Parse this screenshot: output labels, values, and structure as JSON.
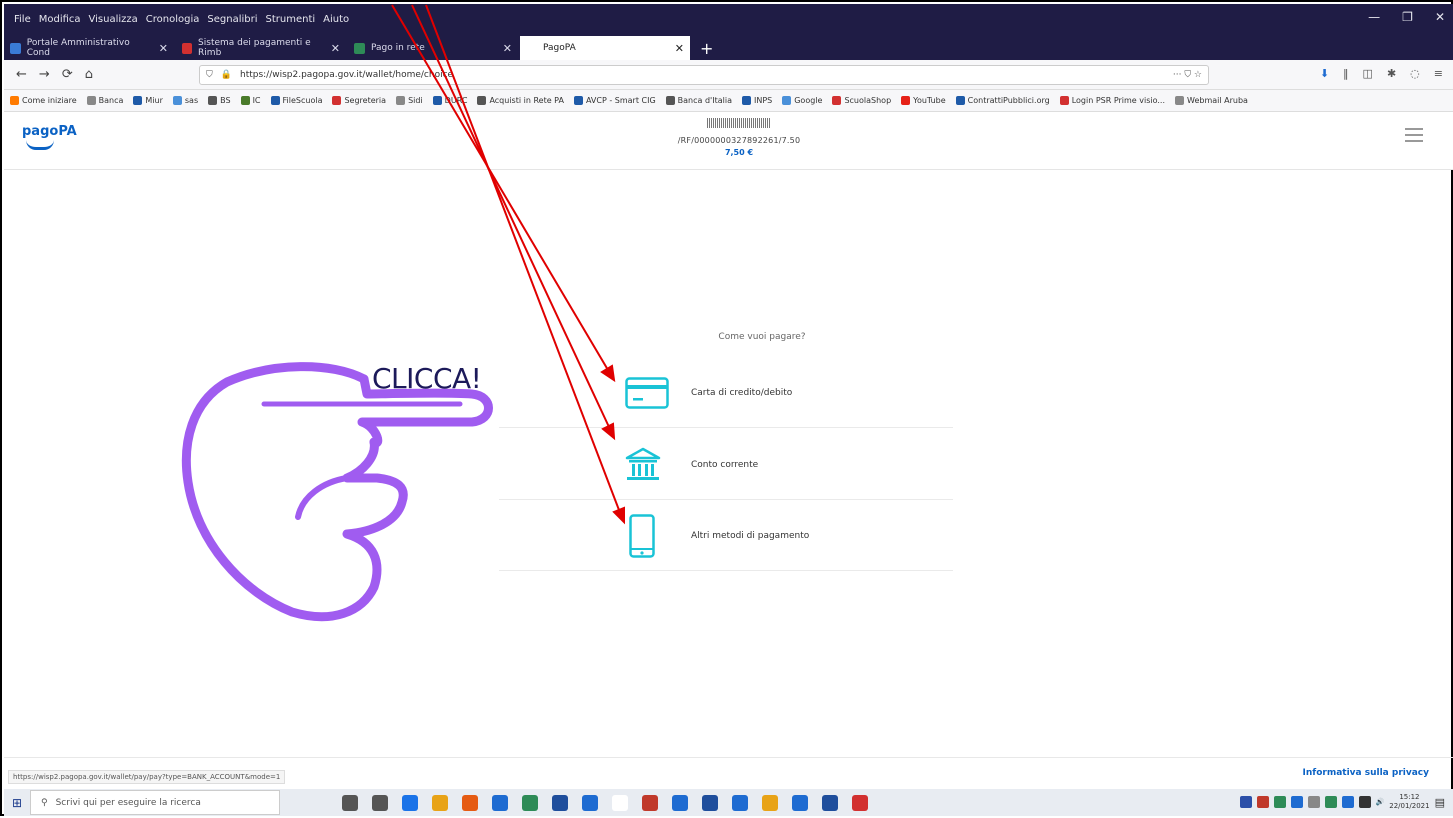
{
  "browser": {
    "menu": [
      "File",
      "Modifica",
      "Visualizza",
      "Cronologia",
      "Segnalibri",
      "Strumenti",
      "Aiuto"
    ],
    "tabs": [
      {
        "label": "Portale Amministrativo Cond",
        "color": "#3a7bd5"
      },
      {
        "label": "Sistema dei pagamenti e Rimb",
        "color": "#d23030"
      },
      {
        "label": "Pago in rete",
        "color": "#2e8b57"
      },
      {
        "label": "PagoPA",
        "color": "#ffffff"
      }
    ],
    "new_tab": "+",
    "url": "https://wisp2.pagopa.gov.it/wallet/home/choice",
    "url_actions": "··· ⛉ ☆",
    "bookmarks": [
      {
        "label": "Come iniziare",
        "color": "#ff7a00"
      },
      {
        "label": "Banca",
        "color": "#888888"
      },
      {
        "label": "Miur",
        "color": "#1e5aa8"
      },
      {
        "label": "sas",
        "color": "#4a90d9"
      },
      {
        "label": "BS",
        "color": "#555555"
      },
      {
        "label": "IC",
        "color": "#4a7a2a"
      },
      {
        "label": "FileScuola",
        "color": "#1e5aa8"
      },
      {
        "label": "Segreteria",
        "color": "#d23030"
      },
      {
        "label": "Sidi",
        "color": "#888888"
      },
      {
        "label": "DURC",
        "color": "#1e5aa8"
      },
      {
        "label": "Acquisti in Rete PA",
        "color": "#555555"
      },
      {
        "label": "AVCP - Smart CIG",
        "color": "#1e5aa8"
      },
      {
        "label": "Banca d'Italia",
        "color": "#555555"
      },
      {
        "label": "INPS",
        "color": "#1e5aa8"
      },
      {
        "label": "Google",
        "color": "#4a90d9"
      },
      {
        "label": "ScuolaShop",
        "color": "#d23030"
      },
      {
        "label": "YouTube",
        "color": "#e62117"
      },
      {
        "label": "ContrattiPubblici.org",
        "color": "#1e5aa8"
      },
      {
        "label": "Login PSR Prime visio...",
        "color": "#d23030"
      },
      {
        "label": "Webmail Aruba",
        "color": "#888888"
      }
    ],
    "status_url": "https://wisp2.pagopa.gov.it/wallet/pay/pay?type=BANK_ACCOUNT&mode=1"
  },
  "page": {
    "logo": "pagoPA",
    "payment_code": "/RF/0000000327892261/7.50",
    "amount": "7,50 €",
    "question": "Come vuoi pagare?",
    "methods": [
      {
        "label": "Carta di credito/debito",
        "icon": "credit-card-icon"
      },
      {
        "label": "Conto corrente",
        "icon": "bank-icon"
      },
      {
        "label": "Altri metodi di pagamento",
        "icon": "smartphone-icon"
      }
    ],
    "privacy_link": "Informativa sulla privacy",
    "accent": "#0b62c4",
    "icon_color": "#19c3d6"
  },
  "annotation": {
    "text": "CLICCA!",
    "hand_color": "#a05cf0",
    "arrow_color": "#e00000"
  },
  "taskbar": {
    "search_placeholder": "Scrivi qui per eseguire la ricerca",
    "time": "15:12",
    "date": "22/01/2021"
  }
}
